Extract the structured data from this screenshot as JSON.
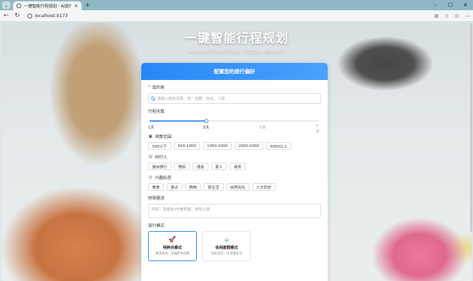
{
  "browser": {
    "tab_title": "一键智能行程规划 · AI旅行助手",
    "url": "localhost:5173"
  },
  "hero": {
    "title": "一键智能行程规划",
    "subtitle": "AI驱动的个性化旅行攻略，让您的每一程都精彩"
  },
  "form": {
    "header": "配置您的旅行偏好",
    "destination": {
      "label": "目的地",
      "required_mark": "*",
      "placeholder": "请输入城市名称，如：成都、杭州、上海"
    },
    "days": {
      "label": "行程天数",
      "marks": [
        "1天",
        "3天",
        "5天",
        "7天"
      ],
      "value": 3,
      "min": 1,
      "max": 7
    },
    "budget": {
      "label": "预算范围",
      "options": [
        "500以下",
        "500-1000",
        "1000-2000",
        "2000-5000",
        "5000以上"
      ]
    },
    "companions": {
      "label": "同行人",
      "options": [
        "独自旅行",
        "情侣",
        "朋友",
        "家人",
        "商务"
      ]
    },
    "interests": {
      "label": "兴趣标签",
      "options": [
        "美食",
        "景点",
        "购物",
        "夜生活",
        "自然风光",
        "人文历史"
      ]
    },
    "special": {
      "label": "特殊需求",
      "placeholder": "例如：我想去IFS看熊猫，想吃火锅"
    },
    "mode": {
      "label": "旅行模式",
      "options": [
        {
          "title": "特种兵模式",
          "desc": "紧凑高效，玩遍所有经典",
          "icon": "rocket-icon",
          "selected": true
        },
        {
          "title": "休闲度假模式",
          "desc": "轻松自在，享受慢生活",
          "icon": "coffee-icon",
          "selected": false
        }
      ]
    }
  },
  "colors": {
    "accent": "#2a86f0",
    "required": "#e53935"
  }
}
